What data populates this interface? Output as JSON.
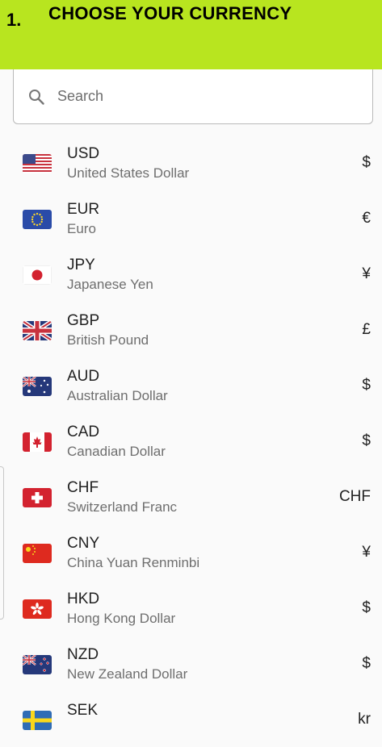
{
  "header": {
    "step_number": "1.",
    "title": "CHOOSE YOUR CURRENCY"
  },
  "search": {
    "placeholder": "Search",
    "icon": "search-icon"
  },
  "currencies": [
    {
      "code": "USD",
      "name": "United States Dollar",
      "symbol": "$",
      "flag": "us-flag-icon"
    },
    {
      "code": "EUR",
      "name": "Euro",
      "symbol": "€",
      "flag": "eu-flag-icon"
    },
    {
      "code": "JPY",
      "name": "Japanese Yen",
      "symbol": "¥",
      "flag": "jp-flag-icon"
    },
    {
      "code": "GBP",
      "name": "British Pound",
      "symbol": "£",
      "flag": "gb-flag-icon"
    },
    {
      "code": "AUD",
      "name": "Australian Dollar",
      "symbol": "$",
      "flag": "au-flag-icon"
    },
    {
      "code": "CAD",
      "name": "Canadian Dollar",
      "symbol": "$",
      "flag": "ca-flag-icon"
    },
    {
      "code": "CHF",
      "name": "Switzerland Franc",
      "symbol": "CHF",
      "flag": "ch-flag-icon"
    },
    {
      "code": "CNY",
      "name": "China Yuan Renminbi",
      "symbol": "¥",
      "flag": "cn-flag-icon"
    },
    {
      "code": "HKD",
      "name": "Hong Kong Dollar",
      "symbol": "$",
      "flag": "hk-flag-icon"
    },
    {
      "code": "NZD",
      "name": "New Zealand Dollar",
      "symbol": "$",
      "flag": "nz-flag-icon"
    },
    {
      "code": "SEK",
      "name": "",
      "symbol": "kr",
      "flag": "se-flag-icon"
    }
  ],
  "colors": {
    "header_bg": "#b8e51f",
    "background": "#fafafa"
  }
}
